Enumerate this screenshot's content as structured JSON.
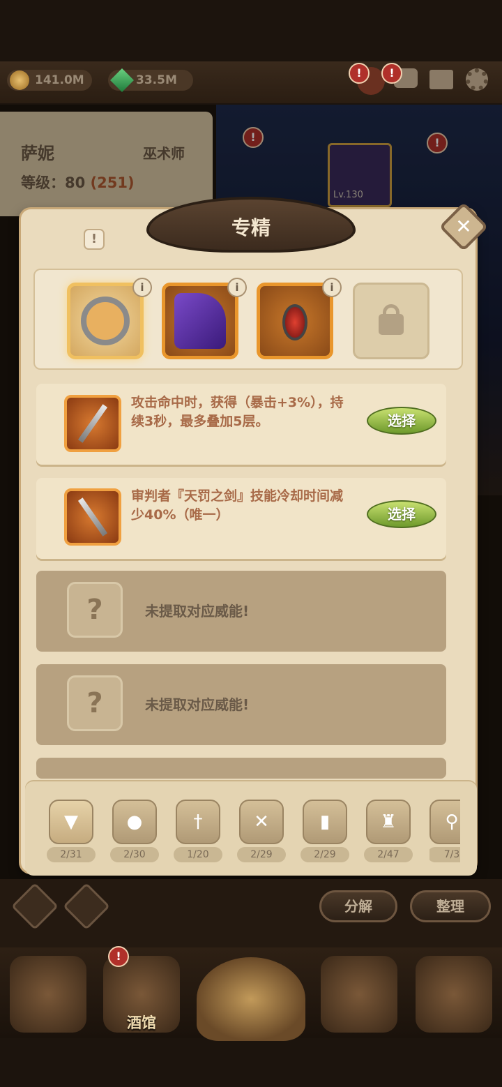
{
  "resources": {
    "gold": "141.0M",
    "gems": "33.5M"
  },
  "hero": {
    "name": "萨妮",
    "class": "巫术师",
    "level_label": "等级：80",
    "level_extra": "(251)"
  },
  "scene": {
    "badge_level": "Lv.130"
  },
  "modal": {
    "title": "专精",
    "close_glyph": "✕",
    "info_glyph": "!",
    "slots": [
      {
        "icon": "ring-slot-icon",
        "state": "selected"
      },
      {
        "icon": "cape-slot-icon",
        "state": "equipped"
      },
      {
        "icon": "amulet-slot-icon",
        "state": "equipped"
      },
      {
        "icon": "lock-icon",
        "state": "locked"
      }
    ],
    "perks": [
      {
        "text": "攻击命中时，获得（暴击+3%），持续3秒，最多叠加5层。",
        "button": "选择",
        "icon": "sword-icon"
      },
      {
        "text": "审判者『天罚之剑』技能冷却时间减少40%（唯一）",
        "button": "选择",
        "icon": "dagger-icon"
      }
    ],
    "empty_perks": [
      {
        "text": "未提取对应威能!",
        "glyph": "?"
      },
      {
        "text": "未提取对应威能!",
        "glyph": "?"
      }
    ]
  },
  "tabs": [
    {
      "icon": "boot-icon",
      "glyph": "▼",
      "count": "2/31"
    },
    {
      "icon": "drumstick-icon",
      "glyph": "●",
      "count": "2/30"
    },
    {
      "icon": "sword-icon",
      "glyph": "†",
      "count": "1/20"
    },
    {
      "icon": "shield-icon",
      "glyph": "✕",
      "count": "2/29"
    },
    {
      "icon": "book-icon",
      "glyph": "▮",
      "count": "2/29"
    },
    {
      "icon": "armor-icon",
      "glyph": "♜",
      "count": "2/47"
    },
    {
      "icon": "magnifier-icon",
      "glyph": "⚲",
      "count": "7/3"
    }
  ],
  "actions": {
    "decompose": "分解",
    "organize": "整理"
  },
  "nav": {
    "tavern": "酒馆"
  },
  "colors": {
    "accent": "#e9962c",
    "select_button": "#6e9a2c",
    "text_brown": "#a86a48"
  }
}
